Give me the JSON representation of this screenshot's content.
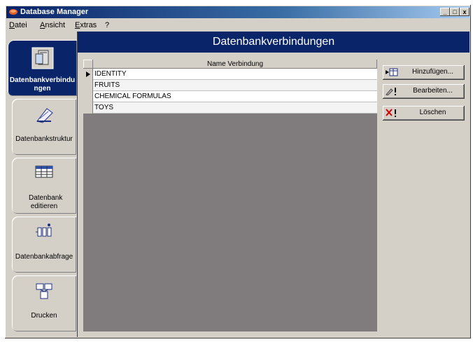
{
  "window": {
    "title": "Database Manager",
    "minimize": "_",
    "maximize": "□",
    "close": "x"
  },
  "menu": [
    "Datei",
    "Ansicht",
    "Extras",
    "?"
  ],
  "nav": [
    {
      "label": "Datenbankverbindungen",
      "icon": "database-connections-icon",
      "active": true
    },
    {
      "label": "Datenbankstruktur",
      "icon": "database-structure-icon"
    },
    {
      "label": "Datenbank editieren",
      "icon": "edit-table-icon"
    },
    {
      "label": "Datenbankabfrage",
      "icon": "query-icon"
    },
    {
      "label": "Drucken",
      "icon": "print-icon"
    }
  ],
  "header": {
    "title": "Datenbankverbindungen"
  },
  "grid": {
    "column": "Name Verbindung",
    "rows": [
      "IDENTITY",
      "FRUITS",
      "CHEMICAL FORMULAS",
      "TOYS"
    ],
    "selected_row": 0
  },
  "actions": [
    {
      "label": "Hinzufügen...",
      "icon": "add-icon"
    },
    {
      "label": "Bearbeiten...",
      "icon": "edit-icon"
    },
    {
      "label": "Löschen",
      "icon": "delete-icon"
    }
  ]
}
